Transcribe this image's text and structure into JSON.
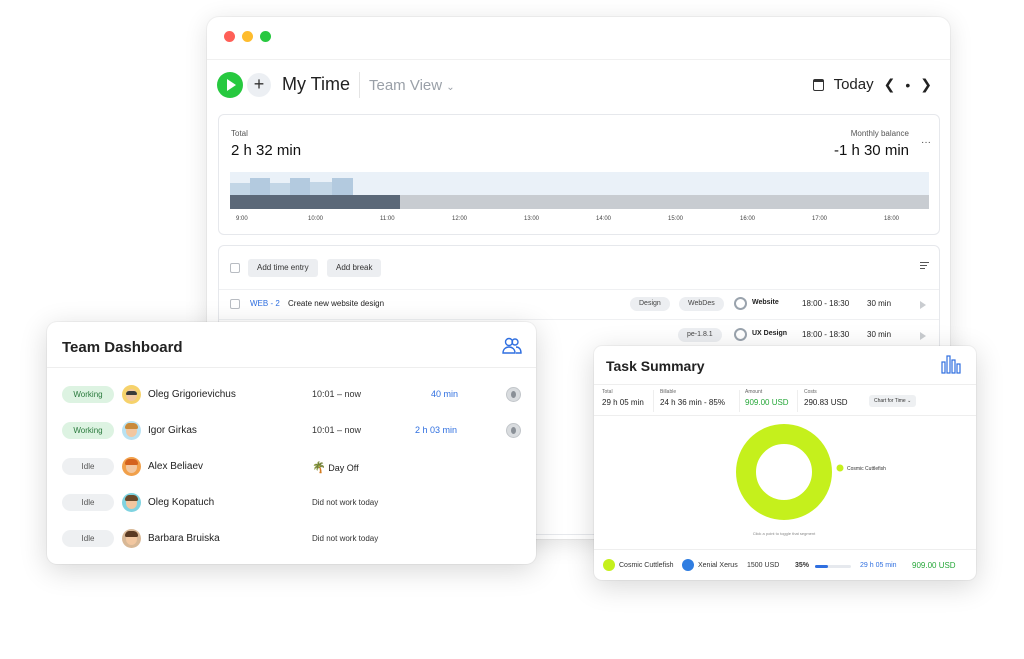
{
  "colors": {
    "accent_green": "#27c93f",
    "link_blue": "#2f6fe0",
    "donut": "#c5f01c",
    "xenial": "#2f7de1"
  },
  "main": {
    "title": "My Time",
    "team_view": "Team View",
    "today": "Today",
    "total_label": "Total",
    "total_value": "2 h 32 min",
    "monthly_label": "Monthly balance",
    "monthly_value": "-1 h 30 min",
    "more": "···",
    "ticks": [
      "9:00",
      "10:00",
      "11:00",
      "12:00",
      "13:00",
      "14:00",
      "15:00",
      "16:00",
      "17:00",
      "18:00"
    ],
    "add_time_entry": "Add time entry",
    "add_break": "Add break",
    "entries": [
      {
        "code": "WEB - 2",
        "desc": "Create new website design",
        "tags": [
          "Design",
          "WebDes"
        ],
        "project": "Website",
        "time": "18:00 - 18:30",
        "duration": "30 min"
      },
      {
        "code": "",
        "desc": "",
        "tags": [
          "pe-1.8.1"
        ],
        "project": "UX Design",
        "time": "18:00 - 18:30",
        "duration": "30 min"
      }
    ]
  },
  "team": {
    "title": "Team Dashboard",
    "members": [
      {
        "status": "Working",
        "name": "Oleg Grigorievichus",
        "time": "10:01  –  now",
        "duration": "40 min"
      },
      {
        "status": "Working",
        "name": "Igor Girkas",
        "time": "10:01  –  now",
        "duration": "2 h 03 min"
      },
      {
        "status": "Idle",
        "name": "Alex Beliaev",
        "time": "Day Off",
        "duration": ""
      },
      {
        "status": "Idle",
        "name": "Oleg Kopatuch",
        "time": "Did not work today",
        "duration": ""
      },
      {
        "status": "Idle",
        "name": "Barbara Bruiska",
        "time": "Did not work today",
        "duration": ""
      }
    ]
  },
  "task": {
    "title": "Task Summary",
    "stats": [
      {
        "label": "Total",
        "value": "29 h 05 min"
      },
      {
        "label": "Billable",
        "value": "24 h 36 min - 85%"
      },
      {
        "label": "Amount",
        "value": "909.00 USD"
      },
      {
        "label": "Costs",
        "value": "290.83 USD"
      }
    ],
    "chart_select": "Chart for Time",
    "legend": "Cosmic Cuttlefish",
    "caption": "Click a point to toggle that segment",
    "footer": {
      "item1": "Cosmic Cuttlefish",
      "item2": "Xenial Xerus",
      "amount": "1500 USD",
      "percent": "35%",
      "percent_value": 35,
      "time": "29 h 05 min",
      "total": "909.00 USD"
    }
  },
  "chart_data": {
    "type": "pie",
    "categories": [
      "Cosmic Cuttlefish"
    ],
    "values": [
      100
    ],
    "title": "",
    "legend": [
      "Cosmic Cuttlefish"
    ]
  }
}
